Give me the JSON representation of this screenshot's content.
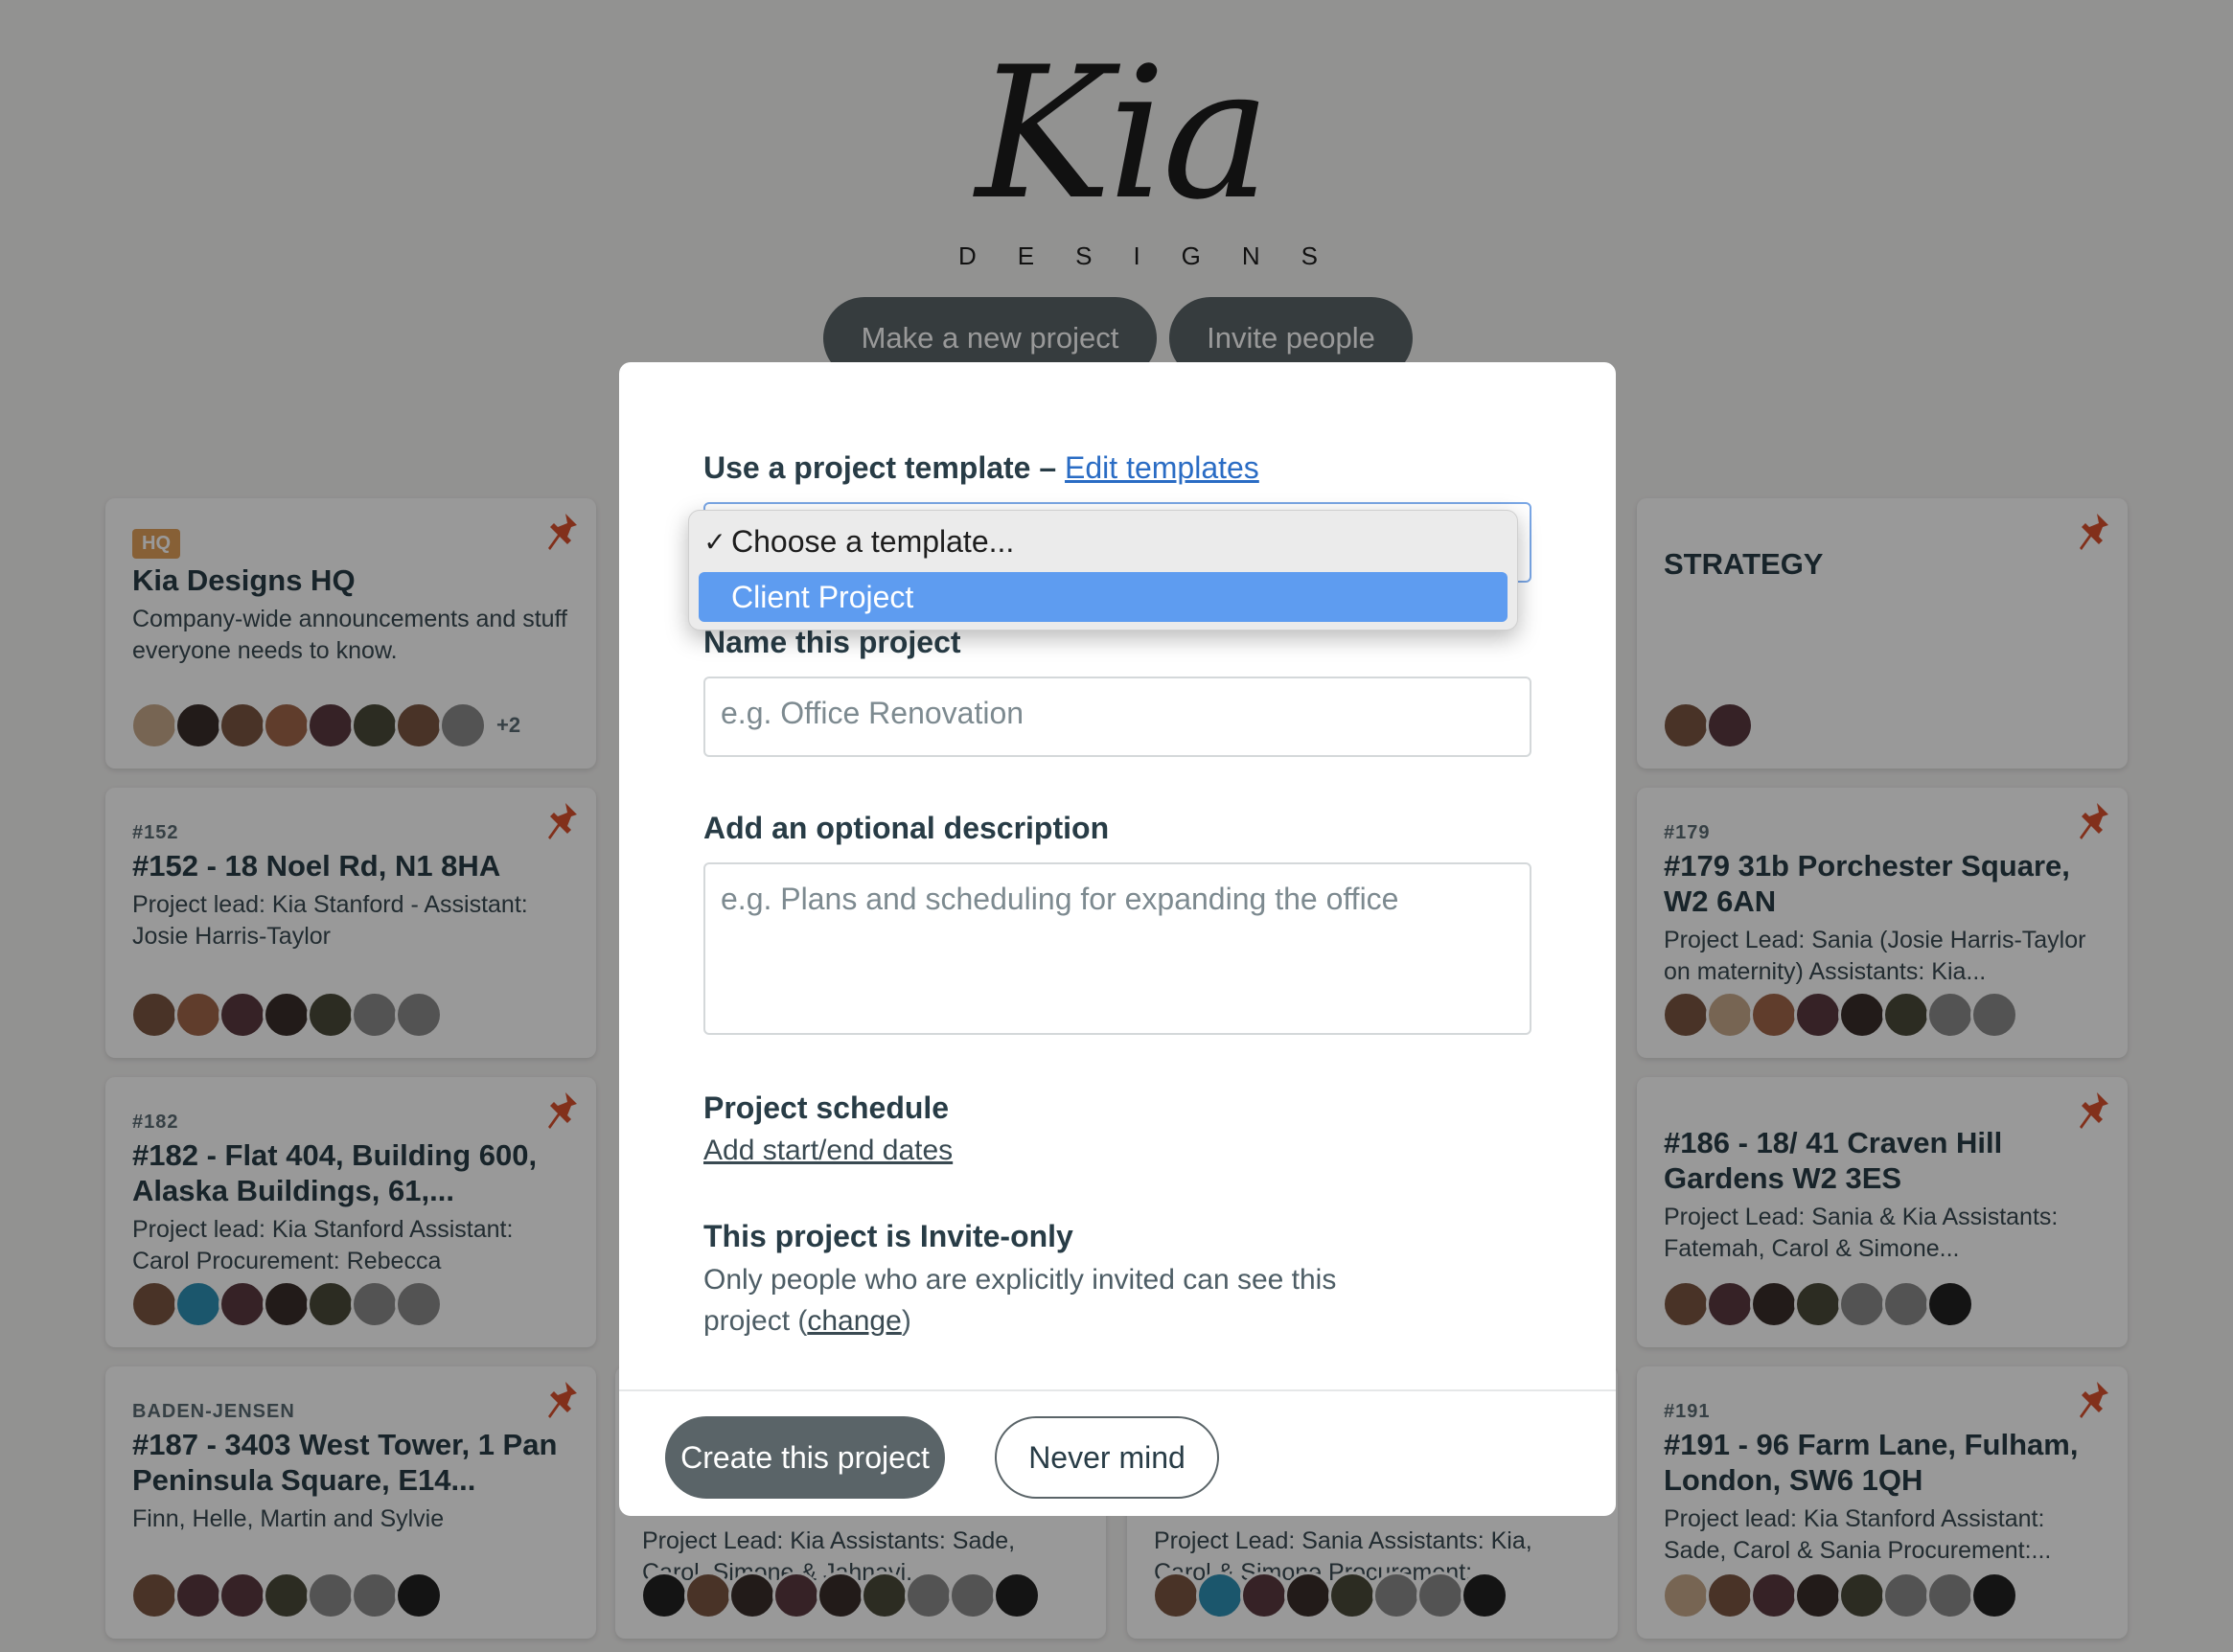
{
  "logo": {
    "script": "Kia",
    "sub": "DESIGNS"
  },
  "toolbar": {
    "new_project": "Make a new project",
    "invite": "Invite people"
  },
  "cards": {
    "hq": {
      "badge": "HQ",
      "title": "Kia Designs HQ",
      "desc": "Company-wide announcements and stuff everyone needs to know.",
      "more": "+2"
    },
    "strategy": {
      "title": "STRATEGY"
    },
    "p152": {
      "eyebrow": "#152",
      "title": "#152 - 18 Noel Rd, N1 8HA",
      "desc": "Project lead: Kia Stanford - Assistant: Josie Harris-Taylor"
    },
    "p179": {
      "eyebrow": "#179",
      "title": "#179 31b Porchester Square, W2 6AN",
      "desc": "Project Lead: Sania (Josie Harris-Taylor on maternity) Assistants: Kia..."
    },
    "p182": {
      "eyebrow": "#182",
      "title": "#182 - Flat 404, Building 600, Alaska Buildings, 61,...",
      "desc": "Project lead: Kia Stanford Assistant: Carol Procurement: Rebecca"
    },
    "p186": {
      "title": "#186 - 18/ 41 Craven Hill Gardens W2 3ES",
      "desc": "Project Lead: Sania & Kia Assistants: Fatemah, Carol & Simone..."
    },
    "p187": {
      "eyebrow": "BADEN-JENSEN",
      "title": "#187 - 3403 West Tower, 1 Pan Peninsula Square, E14...",
      "desc": "Finn, Helle, Martin and Sylvie"
    },
    "p191": {
      "eyebrow": "#191",
      "title": "#191 - 96 Farm Lane, Fulham, London, SW6 1QH",
      "desc": "Project lead: Kia Stanford Assistant: Sade, Carol & Sania Procurement:..."
    },
    "mid_left_desc": "Project Lead: Kia Assistants: Sade, Carol, Simone & Jahnavi...",
    "mid_right_desc": "Project Lead: Sania Assistants: Kia, Carol & Simone Procurement:..."
  },
  "modal": {
    "template_label": "Use a project template",
    "template_sep": " – ",
    "edit_templates": "Edit templates",
    "name_label": "Name this project",
    "name_placeholder": "e.g. Office Renovation",
    "desc_label": "Add an optional description",
    "desc_placeholder": "e.g. Plans and scheduling for expanding the office",
    "schedule_label": "Project schedule",
    "schedule_link": "Add start/end dates",
    "access_label": "This project is Invite-only",
    "access_help": "Only people who are explicitly invited can see this project",
    "access_change": "change",
    "create": "Create this project",
    "cancel": "Never mind"
  },
  "dropdown": {
    "options": [
      "Choose a template...",
      "Client Project"
    ],
    "selected_index": 0,
    "highlighted_index": 1
  },
  "colors": {
    "accent": "#5e9cf0",
    "button": "#5a6468",
    "pin": "#d9502e",
    "badge": "#e2a05a"
  }
}
